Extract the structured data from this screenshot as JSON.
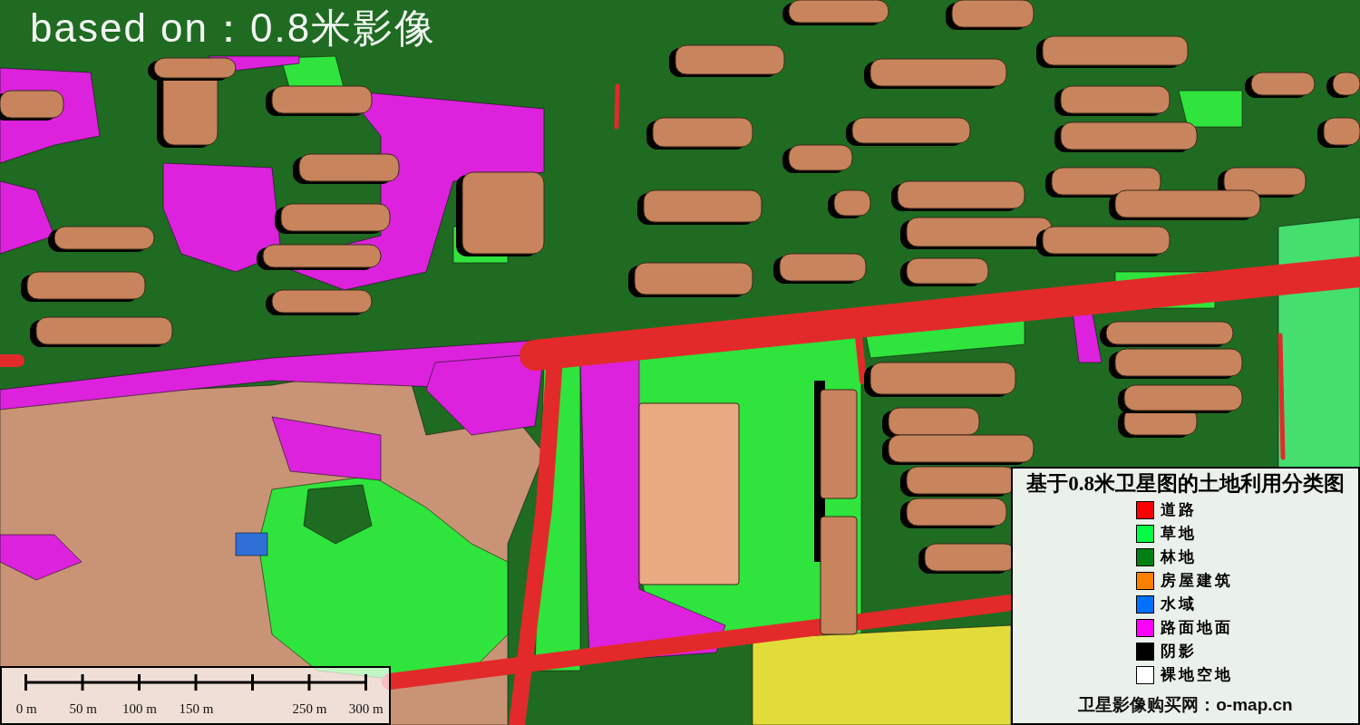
{
  "map_caption": "based on：0.8米影像",
  "legend": {
    "title": "基于0.8米卫星图的土地利用分类图",
    "items": [
      {
        "label": "道路",
        "color": "#ff0000"
      },
      {
        "label": "草地",
        "color": "#00ff44"
      },
      {
        "label": "林地",
        "color": "#008012"
      },
      {
        "label": "房屋建筑",
        "color": "#ff8000"
      },
      {
        "label": "水域",
        "color": "#0070ff"
      },
      {
        "label": "路面地面",
        "color": "#ff00ff"
      },
      {
        "label": "阴影",
        "color": "#000000"
      },
      {
        "label": "裸地空地",
        "color": "#ffffff"
      }
    ],
    "footer": "卫星影像购买网：o-map.cn"
  },
  "scale_bar": {
    "ticks": [
      {
        "kind": "labeled",
        "label": "0 m"
      },
      {
        "kind": "labeled",
        "label": "50 m"
      },
      {
        "kind": "labeled",
        "label": "100 m"
      },
      {
        "kind": "labeled",
        "label": "150 m"
      },
      {
        "kind": "plain"
      },
      {
        "kind": "labeled",
        "label": "250 m"
      },
      {
        "kind": "labeled",
        "label": "300 m"
      }
    ]
  }
}
